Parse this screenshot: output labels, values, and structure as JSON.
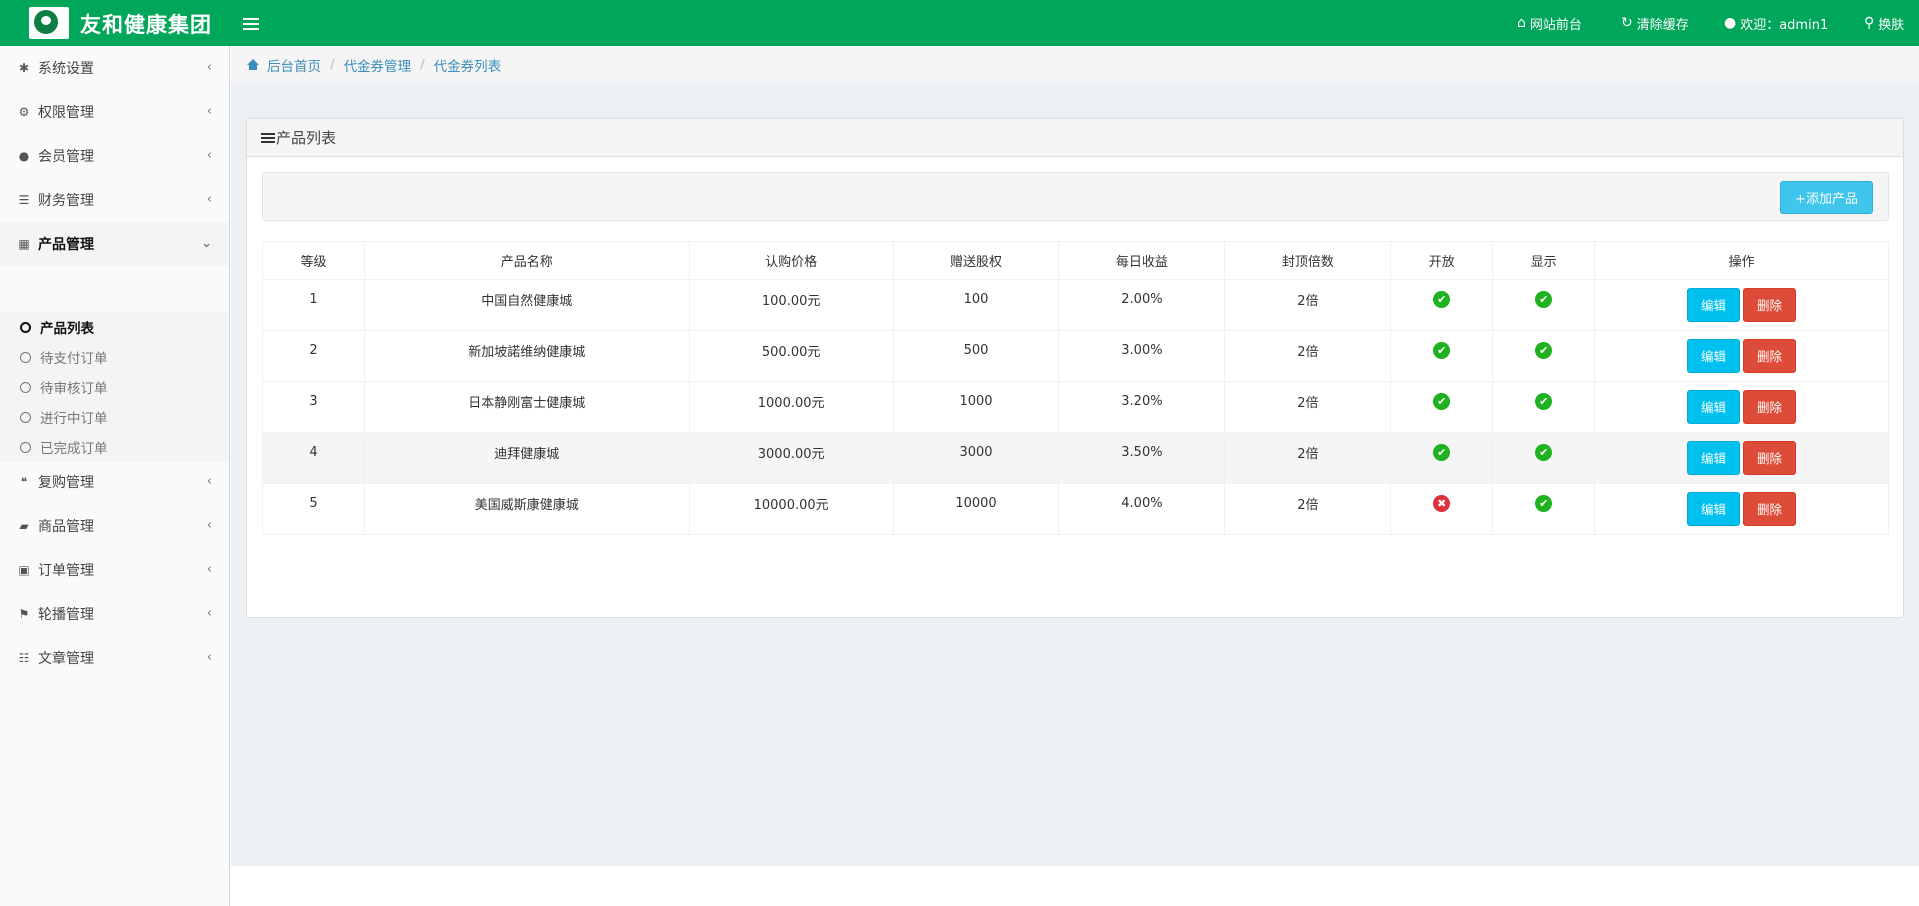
{
  "header": {
    "brand": "友和健康集团",
    "links": [
      {
        "label": "网站前台",
        "icon": "home-icon"
      },
      {
        "label": "清除缓存",
        "icon": "refresh-icon"
      },
      {
        "label": "欢迎：admin1",
        "icon": "user-icon"
      },
      {
        "label": "换肤",
        "icon": "skin-icon"
      }
    ]
  },
  "sidebar": {
    "items": [
      {
        "label": "系统设置",
        "icon": "gear-icon"
      },
      {
        "label": "权限管理",
        "icon": "cogs-icon"
      },
      {
        "label": "会员管理",
        "icon": "user-icon"
      },
      {
        "label": "财务管理",
        "icon": "bars-icon"
      },
      {
        "label": "产品管理",
        "icon": "qrcode-icon"
      },
      {
        "label": "复购管理",
        "icon": "comments-icon"
      },
      {
        "label": "商品管理",
        "icon": "book-icon"
      },
      {
        "label": "订单管理",
        "icon": "money-icon"
      },
      {
        "label": "轮播管理",
        "icon": "flag-icon"
      },
      {
        "label": "文章管理",
        "icon": "server-icon"
      }
    ],
    "submenu": [
      {
        "label": "产品列表"
      },
      {
        "label": "待支付订单"
      },
      {
        "label": "待审核订单"
      },
      {
        "label": "进行中订单"
      },
      {
        "label": "已完成订单"
      }
    ]
  },
  "breadcrumb": [
    "后台首页",
    "代金券管理",
    "代金券列表"
  ],
  "box": {
    "title": "产品列表",
    "add_button": "+添加产品"
  },
  "table": {
    "headers": [
      "等级",
      "产品名称",
      "认购价格",
      "赠送股权",
      "每日收益",
      "封顶倍数",
      "开放",
      "显示",
      "操作"
    ],
    "rows": [
      {
        "level": "1",
        "name": "中国自然健康城",
        "price": "100.00元",
        "equity": "100",
        "daily": "2.00%",
        "cap": "2倍",
        "open": true,
        "show": true
      },
      {
        "level": "2",
        "name": "新加坡諾维纳健康城",
        "price": "500.00元",
        "equity": "500",
        "daily": "3.00%",
        "cap": "2倍",
        "open": true,
        "show": true
      },
      {
        "level": "3",
        "name": "日本静刚富士健康城",
        "price": "1000.00元",
        "equity": "1000",
        "daily": "3.20%",
        "cap": "2倍",
        "open": true,
        "show": true
      },
      {
        "level": "4",
        "name": "迪拜健康城",
        "price": "3000.00元",
        "equity": "3000",
        "daily": "3.50%",
        "cap": "2倍",
        "open": true,
        "show": true
      },
      {
        "level": "5",
        "name": "美国威斯康健康城",
        "price": "10000.00元",
        "equity": "10000",
        "daily": "4.00%",
        "cap": "2倍",
        "open": false,
        "show": true
      }
    ],
    "edit_label": "编辑",
    "delete_label": "删除"
  }
}
